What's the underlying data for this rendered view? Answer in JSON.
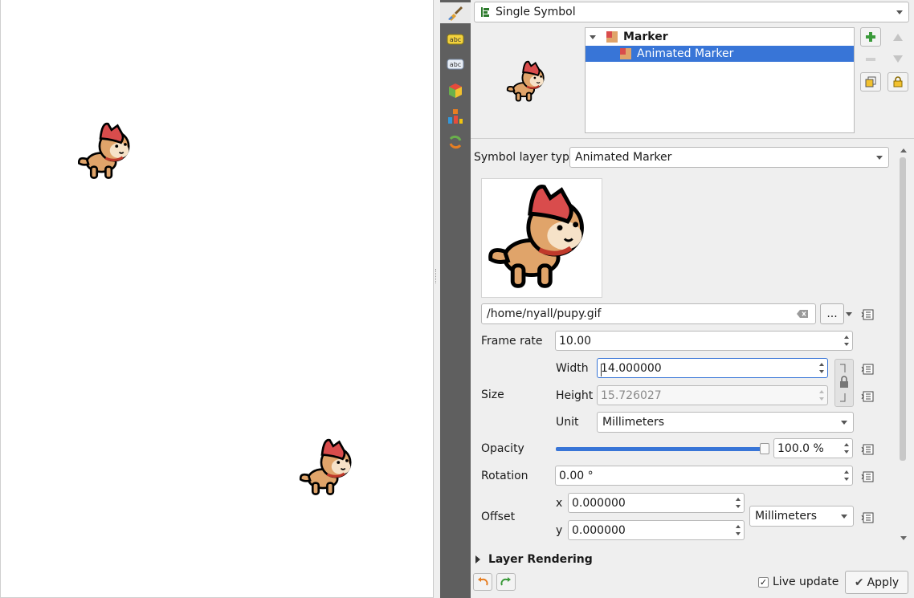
{
  "renderer": {
    "selected": "Single Symbol"
  },
  "symbol_tree": {
    "items": [
      {
        "label": "Marker"
      },
      {
        "label": "Animated Marker"
      }
    ]
  },
  "layer_type": {
    "label": "Symbol layer type",
    "value": "Animated Marker"
  },
  "file": {
    "path": "/home/nyall/pupy.gif",
    "browse_label": "..."
  },
  "frame_rate": {
    "label": "Frame rate",
    "value": "10.00"
  },
  "size": {
    "label": "Size",
    "width_label": "Width",
    "width_value": "14.000000",
    "height_label": "Height",
    "height_value": "15.726027",
    "unit_label": "Unit",
    "unit_value": "Millimeters"
  },
  "opacity": {
    "label": "Opacity",
    "value": "100.0 %",
    "level": 1.0
  },
  "rotation": {
    "label": "Rotation",
    "value": "0.00 °"
  },
  "offset": {
    "label": "Offset",
    "x_label": "x",
    "x_value": "0.000000",
    "y_label": "y",
    "y_value": "0.000000",
    "unit_value": "Millimeters"
  },
  "layer_rendering": {
    "label": "Layer Rendering"
  },
  "footer": {
    "live_update_label": "Live update",
    "live_update_checked": true,
    "apply_label": "Apply"
  },
  "colors": {
    "selection": "#3875d7",
    "toolbar": "#5f5f5f",
    "hat": "#d94c4c",
    "dog": "#e0a46a"
  }
}
